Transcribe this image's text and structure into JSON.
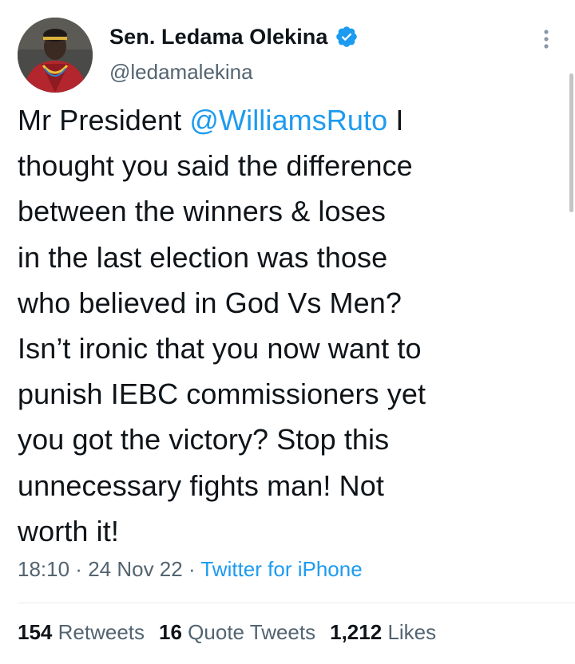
{
  "author": {
    "display_name": "Sen. Ledama Olekina",
    "handle": "@ledamalekina",
    "verified": true,
    "avatar_icon": "profile-photo",
    "verified_icon": "verified-badge-icon",
    "verified_color": "#1d9bf0"
  },
  "tweet": {
    "text_before_mention": "Mr President ",
    "mention": "@WilliamsRuto",
    "text_after_mention": " I\nthought you said the difference\nbetween the winners & loses\nin the last election was those\nwho believed in God Vs Men?\nIsn’t ironic that you now want to\npunish IEBC commissioners yet\nyou got the victory? Stop this\nunnecessary fights man! Not\nworth it!"
  },
  "meta": {
    "time": "18:10",
    "separator": " · ",
    "date": "24 Nov 22",
    "source": "Twitter for iPhone"
  },
  "stats": {
    "retweets_count": "154",
    "retweets_label": "Retweets",
    "quotes_count": "16",
    "quotes_label": "Quote Tweets",
    "likes_count": "1,212",
    "likes_label": "Likes"
  },
  "colors": {
    "text": "#0f1419",
    "secondary": "#536471",
    "link": "#1d9bf0"
  }
}
